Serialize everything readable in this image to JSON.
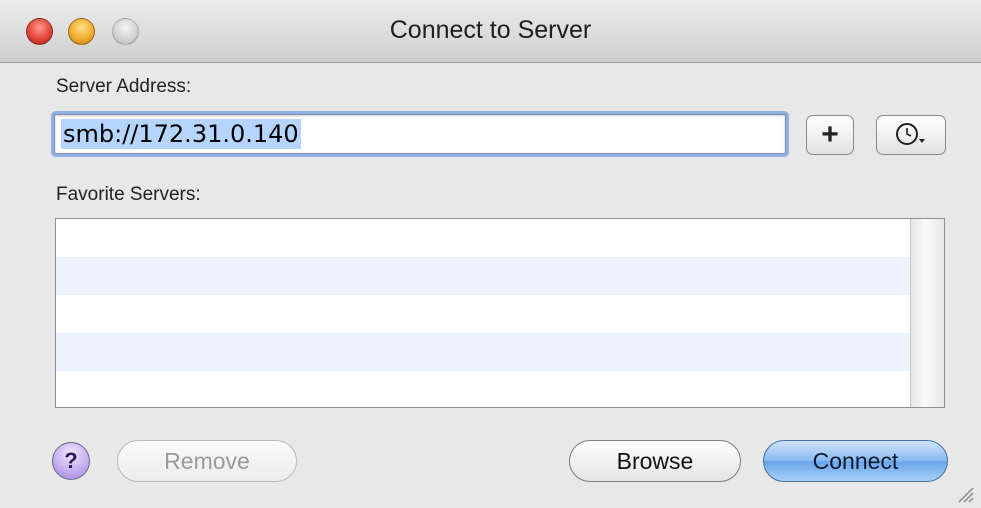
{
  "window": {
    "title": "Connect to Server"
  },
  "server_address": {
    "label": "Server Address:",
    "value": "smb://172.31.0.140"
  },
  "buttons": {
    "add": "+",
    "help": "?",
    "remove": "Remove",
    "browse": "Browse",
    "connect": "Connect"
  },
  "favorites": {
    "label": "Favorite Servers:",
    "items": []
  },
  "icons": [
    "close-icon",
    "minimize-icon",
    "zoom-icon",
    "recent-servers-clock-icon",
    "resize-grip-icon"
  ]
}
